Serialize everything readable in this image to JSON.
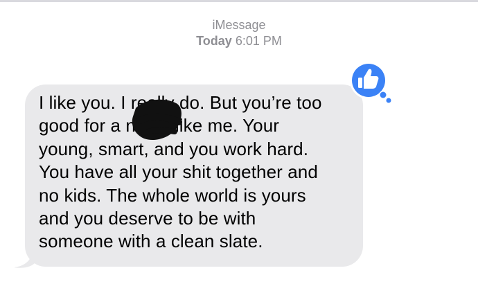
{
  "header": {
    "service": "iMessage",
    "day": "Today",
    "time": "6:01 PM"
  },
  "message": {
    "text": "I like you. I really do. But you’re too\ngood for a nigga like me. Your\nyoung, smart, and you work hard.\nYou have all your shit together and\nno kids. The whole world is yours\nand you deserve to be with\nsomeone with a clean slate.",
    "direction": "incoming"
  },
  "tapback": {
    "icon": "thumbs-up-icon",
    "color": "#3b82f6"
  },
  "colors": {
    "bubble": "#e9e9eb",
    "header_text": "#8e8e93",
    "redaction": "#111111"
  }
}
